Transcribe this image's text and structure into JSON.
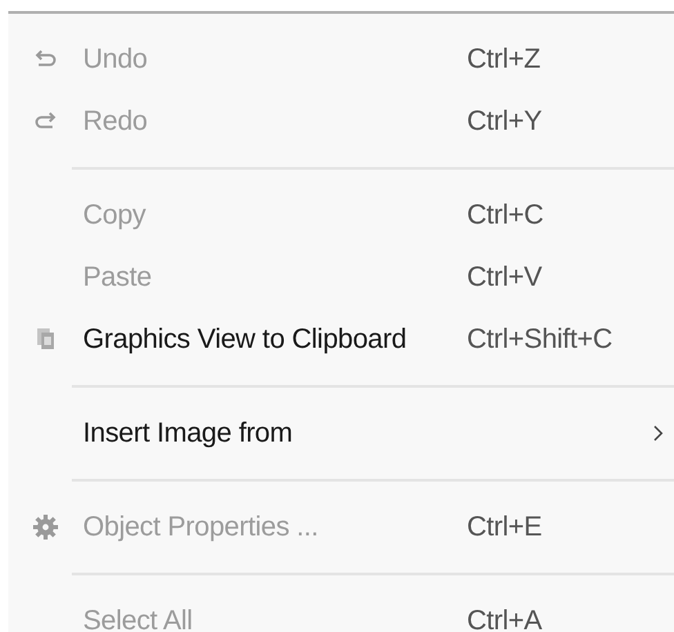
{
  "menu": {
    "items": [
      {
        "kind": "item",
        "label": "Undo",
        "shortcut": "Ctrl+Z",
        "disabled": true
      },
      {
        "kind": "item",
        "label": "Redo",
        "shortcut": "Ctrl+Y",
        "disabled": true
      },
      {
        "kind": "separator"
      },
      {
        "kind": "item",
        "label": "Copy",
        "shortcut": "Ctrl+C",
        "disabled": true
      },
      {
        "kind": "item",
        "label": "Paste",
        "shortcut": "Ctrl+V",
        "disabled": true
      },
      {
        "kind": "item",
        "label": "Graphics View to Clipboard",
        "shortcut": "Ctrl+Shift+C",
        "disabled": false
      },
      {
        "kind": "separator"
      },
      {
        "kind": "submenu",
        "label": "Insert Image from",
        "disabled": false
      },
      {
        "kind": "separator"
      },
      {
        "kind": "item",
        "label": "Object Properties ...",
        "shortcut": "Ctrl+E",
        "disabled": true
      },
      {
        "kind": "separator"
      },
      {
        "kind": "item",
        "label": "Select All",
        "shortcut": "Ctrl+A",
        "disabled": true
      }
    ]
  }
}
